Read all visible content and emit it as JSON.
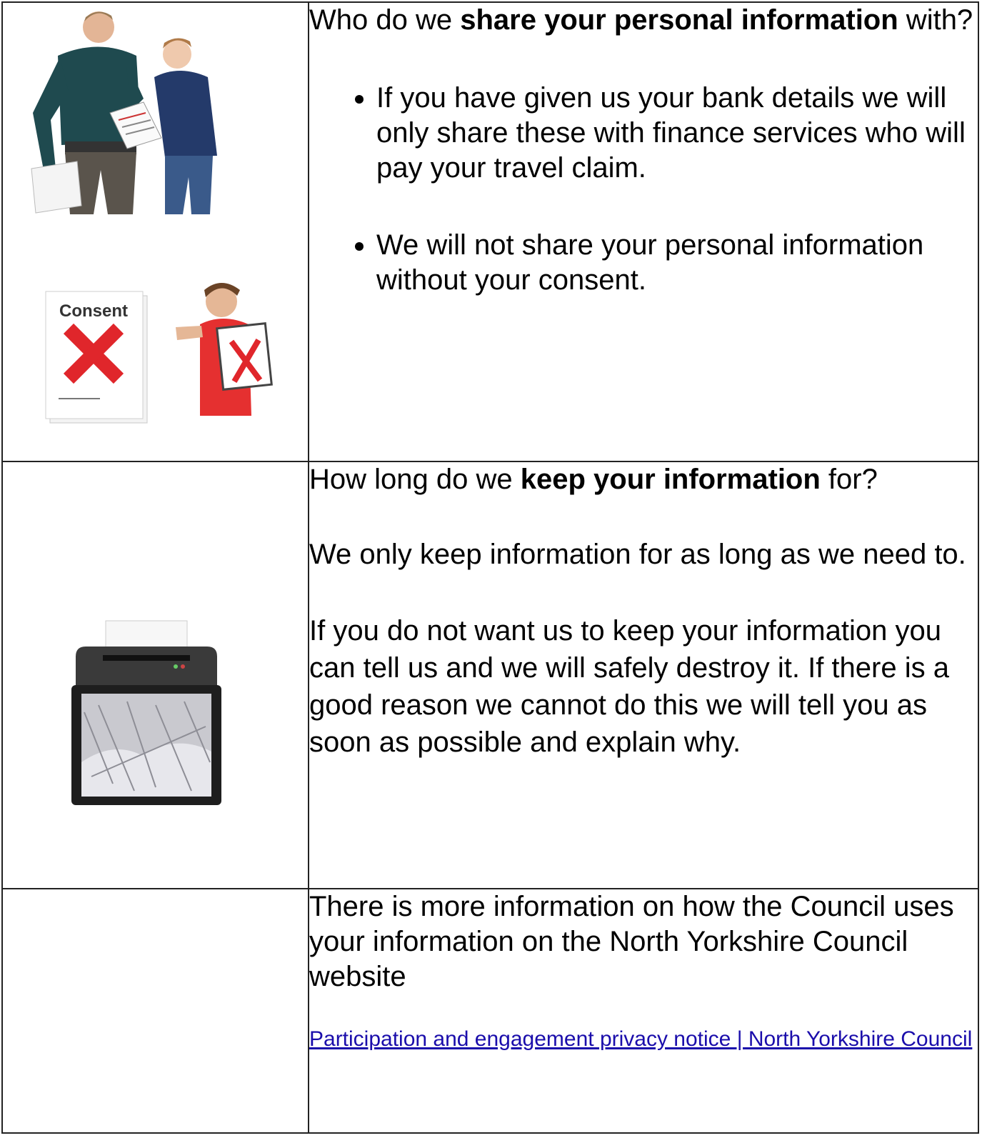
{
  "section_share": {
    "heading_pre": "Who do we ",
    "heading_bold": "share your personal information",
    "heading_post": " with?",
    "bullets": [
      "If you have given us your bank details we will only share these with finance services who will pay your travel claim.",
      "We will not share your personal information without your consent."
    ],
    "consent_card_label": "Consent"
  },
  "section_keep": {
    "heading_pre": "How long do we ",
    "heading_bold": "keep your information",
    "heading_post": " for?",
    "para1": "We only keep information for as long as we need to.",
    "para2": "If you do not want us to keep your information you can tell us and we will safely destroy it. If there is a good reason we cannot do this we will tell you as soon as possible and explain why."
  },
  "section_more": {
    "para": "There is more information on how the Council uses your information on the North Yorkshire Council website",
    "link_text": "Participation and engagement privacy notice | North Yorkshire Council"
  },
  "colors": {
    "link": "#1a0dab",
    "cross_red": "#e0262b",
    "shirt_red": "#e53030"
  }
}
